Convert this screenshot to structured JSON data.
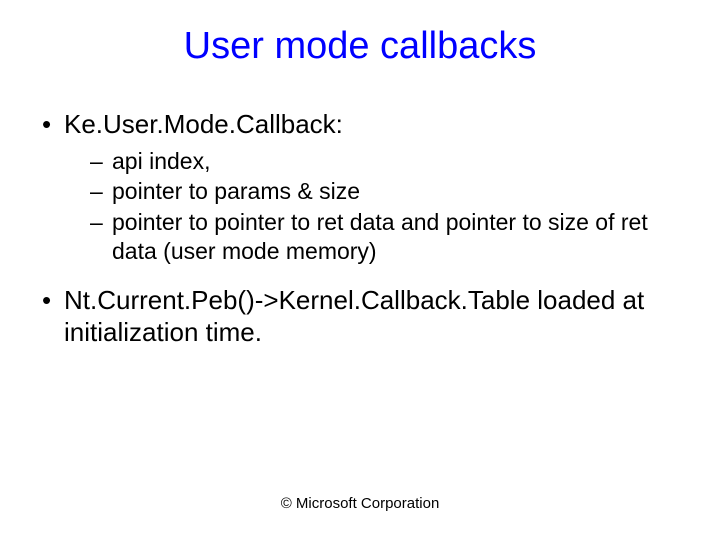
{
  "slide": {
    "title": "User mode callbacks",
    "bullets": [
      {
        "text": "Ke.User.Mode.Callback:",
        "subitems": [
          "api index,",
          "pointer to params & size",
          "pointer to pointer to ret data and pointer to size of ret data (user mode memory)"
        ]
      },
      {
        "text": "Nt.Current.Peb()->Kernel.Callback.Table loaded at initialization time.",
        "subitems": []
      }
    ],
    "footer": "© Microsoft Corporation"
  }
}
